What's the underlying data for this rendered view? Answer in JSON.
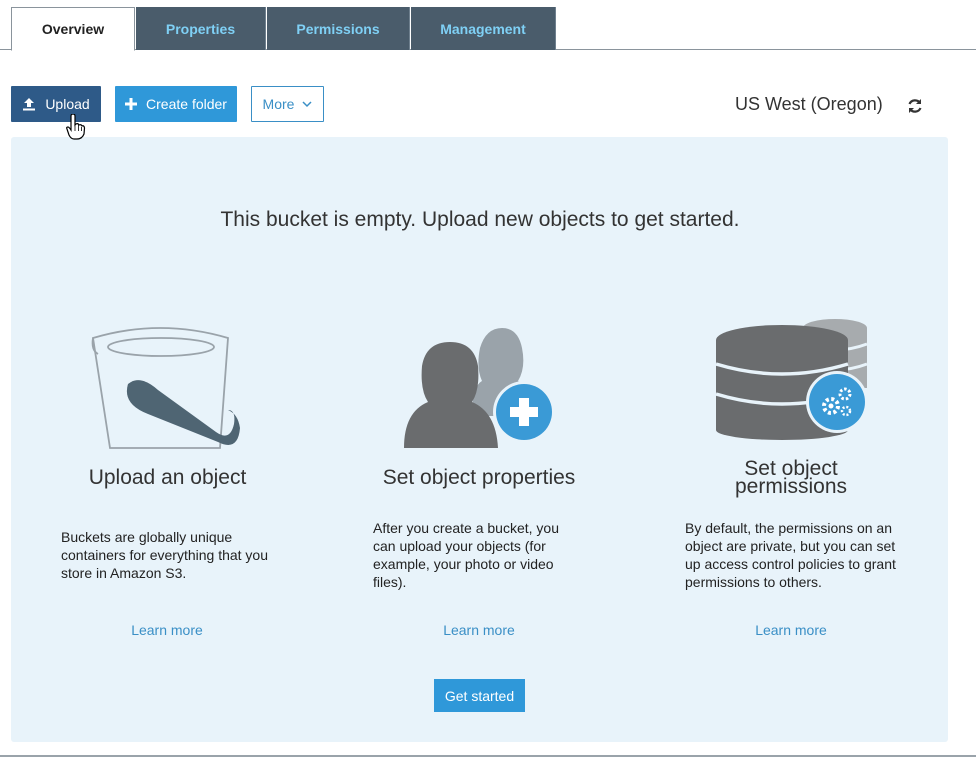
{
  "tabs": [
    {
      "label": "Overview",
      "active": true
    },
    {
      "label": "Properties",
      "active": false
    },
    {
      "label": "Permissions",
      "active": false
    },
    {
      "label": "Management",
      "active": false
    }
  ],
  "toolbar": {
    "upload_label": "Upload",
    "create_folder_label": "Create folder",
    "more_label": "More",
    "region": "US West (Oregon)"
  },
  "panel": {
    "headline": "This bucket is empty. Upload new objects to get started.",
    "columns": [
      {
        "title": "Upload an object",
        "description": "Buckets are globally unique containers for everything that you store in Amazon S3.",
        "link": "Learn more"
      },
      {
        "title": "Set object properties",
        "description": "After you create a bucket, you can upload your objects (for example, your photo or video files).",
        "link": "Learn more"
      },
      {
        "title": "Set object permissions",
        "description": "By default, the permissions on an object are private, but you can set up access control policies to grant permissions to others.",
        "link": "Learn more"
      }
    ],
    "cta_label": "Get started"
  },
  "colors": {
    "tab_dark": "#4a5c6b",
    "tab_text": "#7fd0f5",
    "upload_btn": "#2e5a88",
    "primary_btn": "#2f98d9",
    "panel_bg": "#e8f3fa",
    "link": "#3a8fc6"
  },
  "icons": [
    "upload-icon",
    "plus-icon",
    "chevron-down-icon",
    "refresh-icon",
    "bucket-icon",
    "users-add-icon",
    "database-gear-icon",
    "hand-cursor-icon"
  ]
}
